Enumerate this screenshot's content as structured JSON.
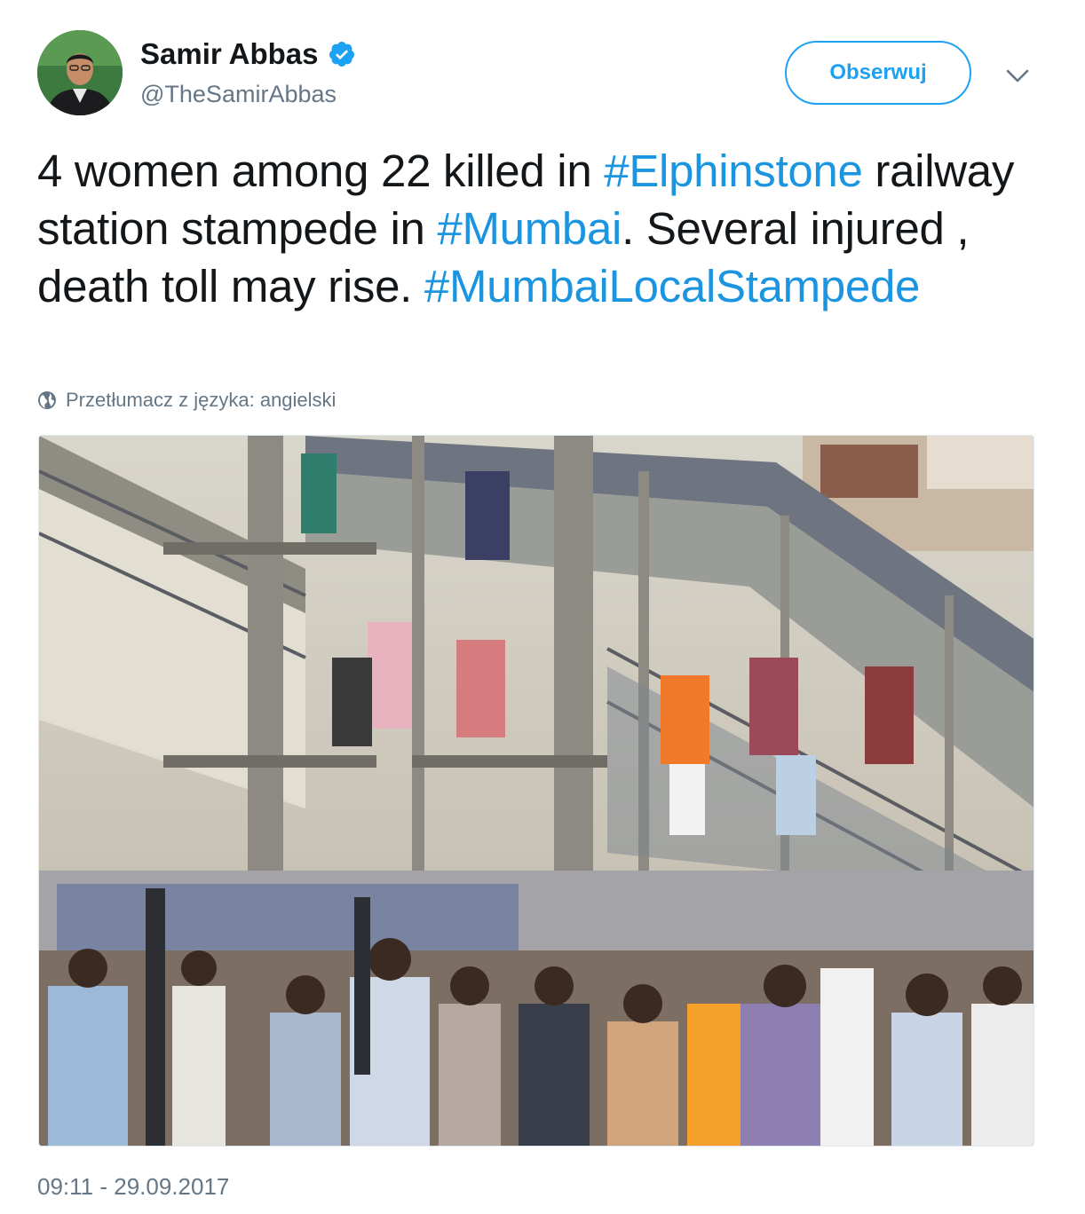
{
  "author": {
    "display_name": "Samir Abbas",
    "handle": "@TheSamirAbbas",
    "verified": true,
    "avatar_icon": "person-avatar"
  },
  "actions": {
    "follow_label": "Obserwuj",
    "menu_icon": "chevron-down-icon"
  },
  "tweet": {
    "segments": [
      {
        "text": "4 women among 22 killed in ",
        "hashtag": false
      },
      {
        "text": "#Elphinstone",
        "hashtag": true
      },
      {
        "text": " railway station stampede in ",
        "hashtag": false
      },
      {
        "text": "#Mumbai",
        "hashtag": true
      },
      {
        "text": ". Several injured , death toll may rise. ",
        "hashtag": false
      },
      {
        "text": "#MumbaiLocalStampede",
        "hashtag": true
      }
    ]
  },
  "translate": {
    "label": "Przetłumacz z języka: angielski",
    "icon": "globe-icon"
  },
  "media": {
    "type": "photo"
  },
  "timestamp": "09:11 - 29.09.2017",
  "colors": {
    "link": "#1b95e0",
    "brand": "#1da1f2",
    "text": "#14171a",
    "muted": "#657786"
  }
}
